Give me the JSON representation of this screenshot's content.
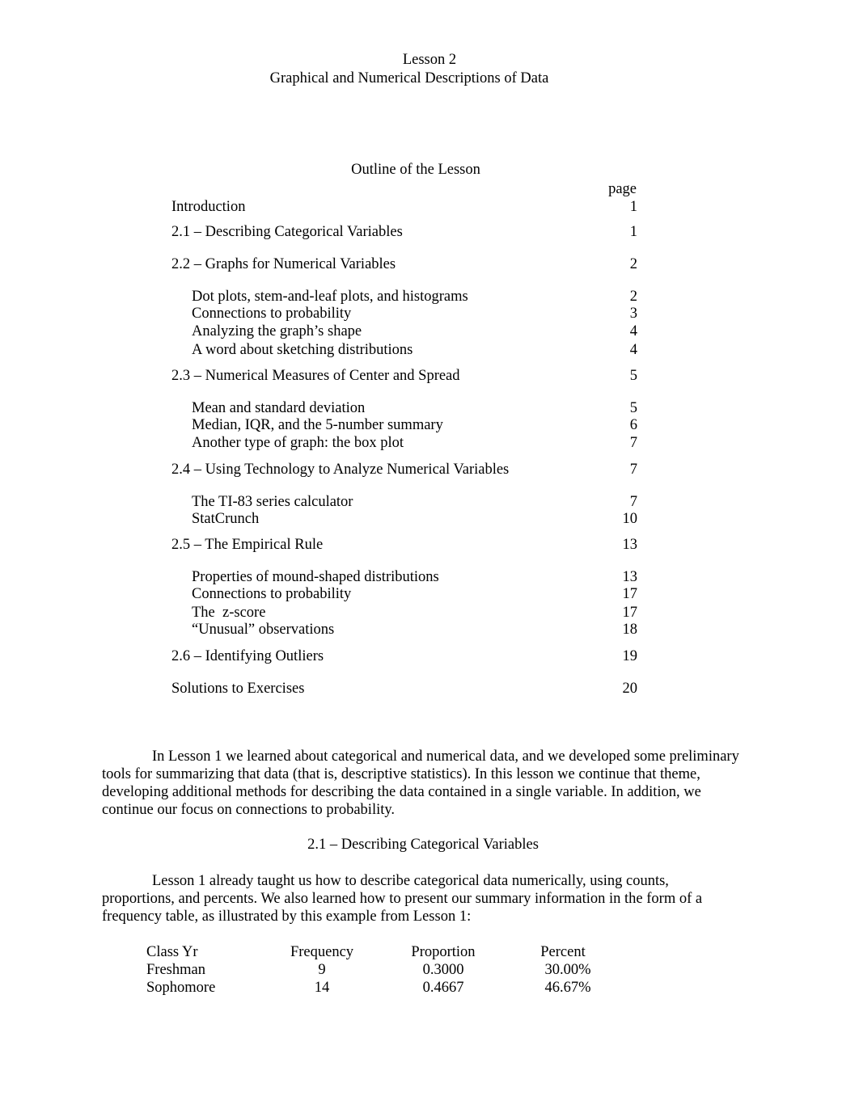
{
  "document": {
    "title": "Lesson 2",
    "subtitle": "Graphical and Numerical Descriptions of Data"
  },
  "outline": {
    "heading": "Outline of the Lesson",
    "page_column_header": "page",
    "entries": [
      {
        "label": "Introduction",
        "page": "1",
        "level": 1
      },
      {
        "label": "2.1 – Describing Categorical Variables",
        "page": "1",
        "level": 1
      },
      {
        "label": "2.2 – Graphs for Numerical Variables",
        "page": "2",
        "level": 1
      },
      {
        "label": "Dot plots, stem-and-leaf plots, and histograms",
        "page": "2",
        "level": 2
      },
      {
        "label": "Connections to probability",
        "page": "3",
        "level": 2
      },
      {
        "label": "Analyzing the graph’s shape",
        "page": "4",
        "level": 2
      },
      {
        "label": "A word about sketching distributions",
        "page": "4",
        "level": 2
      },
      {
        "label": "2.3 – Numerical Measures of Center and Spread",
        "page": "5",
        "level": 1
      },
      {
        "label": "Mean and standard deviation",
        "page": "5",
        "level": 2
      },
      {
        "label": "Median, IQR, and the 5-number summary",
        "page": "6",
        "level": 2
      },
      {
        "label": "Another type of graph: the box plot",
        "page": "7",
        "level": 2
      },
      {
        "label": "2.4 – Using Technology to Analyze Numerical Variables",
        "page": "7",
        "level": 1
      },
      {
        "label": "The TI-83 series calculator",
        "page": "7",
        "level": 2
      },
      {
        "label": "StatCrunch",
        "page": "10",
        "level": 2
      },
      {
        "label": "2.5 – The Empirical Rule",
        "page": "13",
        "level": 1
      },
      {
        "label": "Properties of mound-shaped distributions",
        "page": "13",
        "level": 2
      },
      {
        "label": "Connections to probability",
        "page": "17",
        "level": 2
      },
      {
        "label": "The  z-score",
        "page": "17",
        "level": 2
      },
      {
        "label": "“Unusual” observations",
        "page": "18",
        "level": 2
      },
      {
        "label": "2.6 – Identifying Outliers",
        "page": "19",
        "level": 1
      },
      {
        "label": "Solutions to Exercises",
        "page": "20",
        "level": 1
      }
    ]
  },
  "intro_paragraph": {
    "lines": [
      "In Lesson 1 we learned about categorical and numerical data, and we developed some preliminary",
      "tools for summarizing that data (that is, descriptive statistics).  In this lesson we continue that theme,",
      "developing additional methods for describing the data contained in a single variable.  In addition, we",
      "continue our focus on connections to probability."
    ]
  },
  "section_2_1": {
    "heading": "2.1 – Describing Categorical Variables",
    "paragraph_lines": [
      "Lesson 1 already taught us how to describe categorical data numerically, using counts,",
      "proportions, and percents.  We also learned how to present our summary information in the form of a",
      "frequency table, as illustrated by this example from Lesson 1:"
    ],
    "frequency_table": {
      "headers": [
        "Class Yr",
        "Frequency",
        "Proportion",
        "Percent"
      ],
      "rows": [
        [
          "Freshman",
          "9",
          "0.3000",
          "30.00%"
        ],
        [
          "Sophomore",
          "14",
          "0.4667",
          "46.67%"
        ]
      ]
    }
  }
}
